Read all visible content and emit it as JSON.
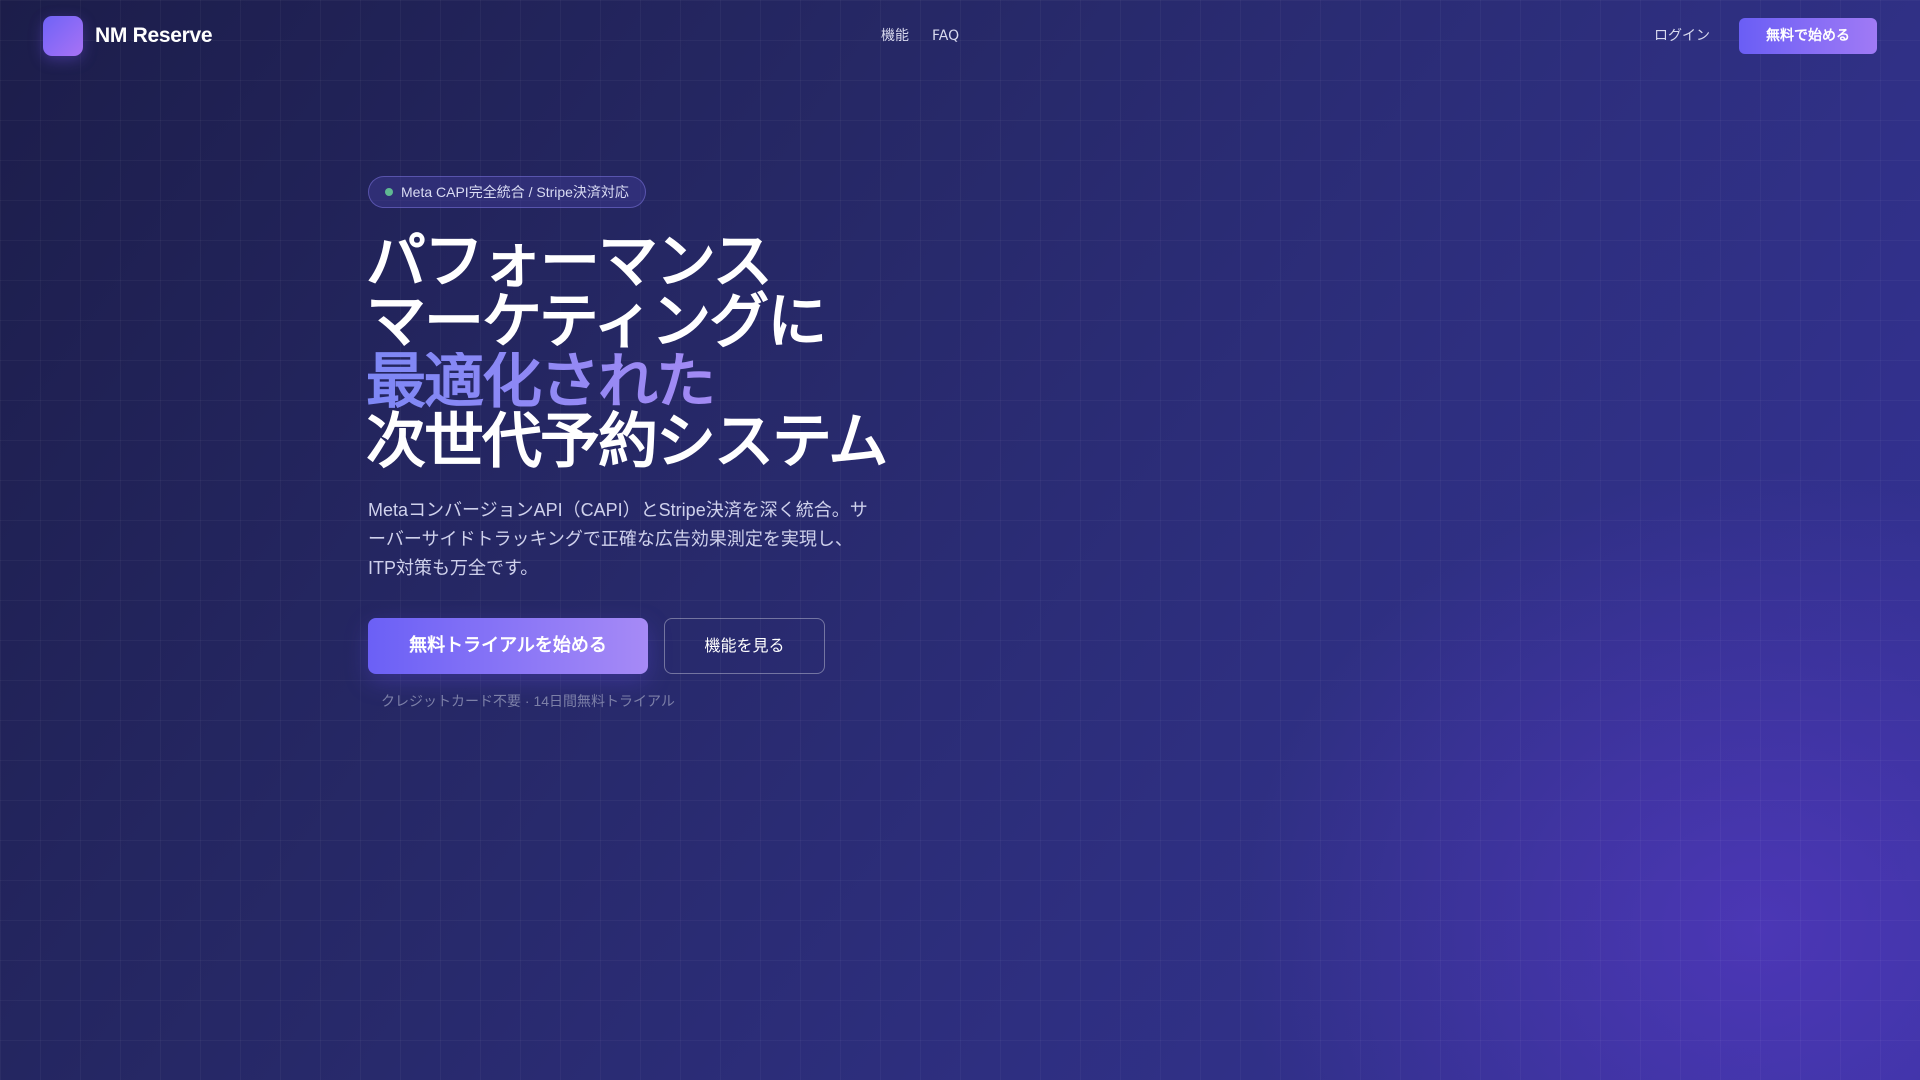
{
  "header": {
    "brand_name": "NM Reserve",
    "nav": [
      {
        "label": "機能"
      },
      {
        "label": "FAQ"
      }
    ],
    "login_label": "ログイン",
    "cta_label": "無料で始める"
  },
  "hero": {
    "badge": "Meta CAPI完全統合 / Stripe決済対応",
    "headline": {
      "line1": "パフォーマンス",
      "line2": "マーケティングに",
      "line3_accent": "最適化された",
      "line4": "次世代予約システム"
    },
    "description": "MetaコンバージョンAPI（CAPI）とStripe決済を深く統合。サーバーサイドトラッキングで正確な広告効果測定を実現し、ITP対策も万全です。",
    "primary_cta": "無料トライアルを始める",
    "secondary_cta": "機能を見る",
    "note": "クレジットカード不要 · 14日間無料トライアル"
  },
  "colors": {
    "background_start": "#1c1d4a",
    "background_end": "#36329a",
    "accent_start": "#6a5ef5",
    "accent_end": "#a68af6",
    "badge_dot": "#5fb892"
  }
}
